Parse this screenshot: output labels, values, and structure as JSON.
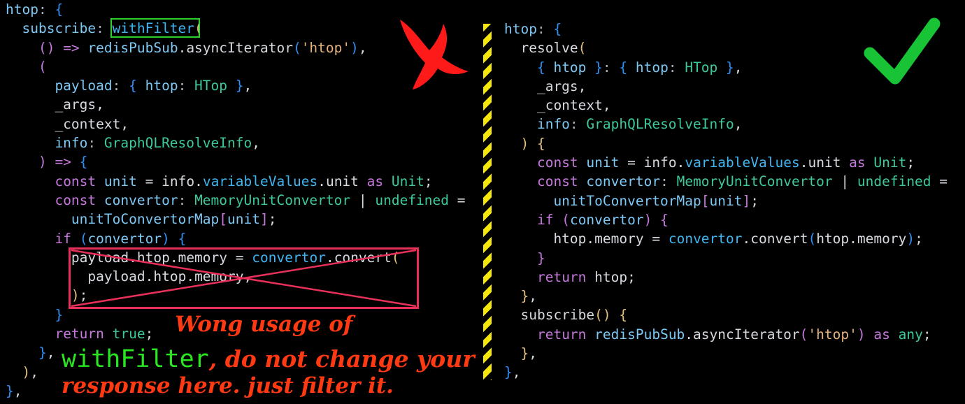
{
  "colors": {
    "background": "#000000",
    "divider_stripe": "#f5e60b",
    "highlight_box": "#2ed12e",
    "strike_box": "#e8305a",
    "annotation_red": "#ff3a12",
    "annotation_green": "#29e621",
    "check_green": "#18c436",
    "cross_red": "#ff1a1a"
  },
  "icons": {
    "wrong": "red-x-mark-icon",
    "right": "green-checkmark-icon"
  },
  "left_code": {
    "lines": [
      [
        [
          "htop",
          "c-prop"
        ],
        [
          ": ",
          "c-key"
        ],
        [
          "{",
          "c-brace"
        ]
      ],
      [
        [
          "  subscribe",
          "c-prop"
        ],
        [
          ": ",
          "c-key"
        ],
        [
          "withFilter",
          "c-func"
        ],
        [
          "(",
          "c-brace3"
        ]
      ],
      [
        [
          "    ",
          "c-plain"
        ],
        [
          "() => ",
          "c-kw"
        ],
        [
          "redisPubSub",
          "c-prop"
        ],
        [
          ".",
          "c-plain"
        ],
        [
          "asyncIterator",
          "c-plain"
        ],
        [
          "(",
          "c-brace"
        ],
        [
          "'htop'",
          "c-str"
        ],
        [
          ")",
          "c-brace"
        ],
        [
          ",",
          "c-plain"
        ]
      ],
      [
        [
          "    ",
          "c-plain"
        ],
        [
          "(",
          "c-brace2"
        ]
      ],
      [
        [
          "      payload",
          "c-prop"
        ],
        [
          ": ",
          "c-key"
        ],
        [
          "{ ",
          "c-brace"
        ],
        [
          "htop",
          "c-prop"
        ],
        [
          ": ",
          "c-key"
        ],
        [
          "HTop ",
          "c-type"
        ],
        [
          "}",
          "c-brace"
        ],
        [
          ",",
          "c-plain"
        ]
      ],
      [
        [
          "      _args,",
          "c-plain"
        ]
      ],
      [
        [
          "      _context,",
          "c-plain"
        ]
      ],
      [
        [
          "      info",
          "c-prop"
        ],
        [
          ": ",
          "c-key"
        ],
        [
          "GraphQLResolveInfo",
          "c-type"
        ],
        [
          ",",
          "c-plain"
        ]
      ],
      [
        [
          "    ",
          "c-plain"
        ],
        [
          ") => ",
          "c-brace2"
        ],
        [
          "{",
          "c-brace"
        ]
      ],
      [
        [
          "      ",
          "c-plain"
        ],
        [
          "const ",
          "c-kw"
        ],
        [
          "unit",
          "c-prop"
        ],
        [
          " = ",
          "c-plain"
        ],
        [
          "info",
          "c-plain"
        ],
        [
          ".",
          "c-plain"
        ],
        [
          "variableValues",
          "c-func"
        ],
        [
          ".",
          "c-plain"
        ],
        [
          "unit ",
          "c-plain"
        ],
        [
          "as ",
          "c-kw"
        ],
        [
          "Unit",
          "c-type"
        ],
        [
          ";",
          "c-plain"
        ]
      ],
      [
        [
          "      ",
          "c-plain"
        ],
        [
          "const ",
          "c-kw"
        ],
        [
          "convertor",
          "c-prop"
        ],
        [
          ": ",
          "c-key"
        ],
        [
          "MemoryUnitConvertor ",
          "c-type"
        ],
        [
          "| ",
          "c-plain"
        ],
        [
          "undefined ",
          "c-type"
        ],
        [
          "=",
          "c-plain"
        ]
      ],
      [
        [
          "        unitToConvertorMap",
          "c-prop"
        ],
        [
          "[",
          "c-brace2"
        ],
        [
          "unit",
          "c-prop"
        ],
        [
          "]",
          "c-brace2"
        ],
        [
          ";",
          "c-plain"
        ]
      ],
      [
        [
          "      ",
          "c-plain"
        ],
        [
          "if ",
          "c-kw"
        ],
        [
          "(",
          "c-brace"
        ],
        [
          "convertor",
          "c-prop"
        ],
        [
          ") ",
          "c-brace"
        ],
        [
          "{",
          "c-brace"
        ]
      ],
      [
        [
          "        payload",
          "c-plain"
        ],
        [
          ".",
          "c-plain"
        ],
        [
          "htop",
          "c-plain"
        ],
        [
          ".",
          "c-plain"
        ],
        [
          "memory",
          "c-plain"
        ],
        [
          " = ",
          "c-plain"
        ],
        [
          "convertor",
          "c-func"
        ],
        [
          ".",
          "c-plain"
        ],
        [
          "convert",
          "c-plain"
        ],
        [
          "(",
          "c-brace3"
        ]
      ],
      [
        [
          "          payload",
          "c-plain"
        ],
        [
          ".",
          "c-plain"
        ],
        [
          "htop",
          "c-plain"
        ],
        [
          ".",
          "c-plain"
        ],
        [
          "memory",
          "c-plain"
        ],
        [
          ",",
          "c-plain"
        ]
      ],
      [
        [
          "        ",
          "c-plain"
        ],
        [
          ")",
          "c-brace3"
        ],
        [
          ";",
          "c-plain"
        ]
      ],
      [
        [
          "      ",
          "c-plain"
        ],
        [
          "}",
          "c-brace"
        ]
      ],
      [
        [
          "      ",
          "c-plain"
        ],
        [
          "return ",
          "c-kw"
        ],
        [
          "true",
          "c-type"
        ],
        [
          ";",
          "c-plain"
        ]
      ],
      [
        [
          "    ",
          "c-plain"
        ],
        [
          "}",
          "c-brace"
        ],
        [
          ",",
          "c-plain"
        ]
      ],
      [
        [
          "  ",
          "c-plain"
        ],
        [
          ")",
          "c-brace3"
        ],
        [
          ",",
          "c-plain"
        ]
      ],
      [
        [
          "}",
          "c-brace"
        ],
        [
          ",",
          "c-plain"
        ]
      ]
    ]
  },
  "right_code": {
    "lines": [
      [
        [
          "htop",
          "c-prop"
        ],
        [
          ": ",
          "c-key"
        ],
        [
          "{",
          "c-brace"
        ]
      ],
      [
        [
          "  resolve",
          "c-plain"
        ],
        [
          "(",
          "c-brace3"
        ]
      ],
      [
        [
          "    ",
          "c-plain"
        ],
        [
          "{ ",
          "c-brace"
        ],
        [
          "htop ",
          "c-prop"
        ],
        [
          "}",
          "c-brace"
        ],
        [
          ": ",
          "c-key"
        ],
        [
          "{ ",
          "c-brace"
        ],
        [
          "htop",
          "c-prop"
        ],
        [
          ": ",
          "c-key"
        ],
        [
          "HTop ",
          "c-type"
        ],
        [
          "}",
          "c-brace"
        ],
        [
          ",",
          "c-plain"
        ]
      ],
      [
        [
          "    _args,",
          "c-plain"
        ]
      ],
      [
        [
          "    _context,",
          "c-plain"
        ]
      ],
      [
        [
          "    info",
          "c-prop"
        ],
        [
          ": ",
          "c-key"
        ],
        [
          "GraphQLResolveInfo",
          "c-type"
        ],
        [
          ",",
          "c-plain"
        ]
      ],
      [
        [
          "  ",
          "c-plain"
        ],
        [
          ") ",
          "c-brace3"
        ],
        [
          "{",
          "c-brace3"
        ]
      ],
      [
        [
          "    ",
          "c-plain"
        ],
        [
          "const ",
          "c-kw"
        ],
        [
          "unit",
          "c-prop"
        ],
        [
          " = ",
          "c-plain"
        ],
        [
          "info",
          "c-plain"
        ],
        [
          ".",
          "c-plain"
        ],
        [
          "variableValues",
          "c-func"
        ],
        [
          ".",
          "c-plain"
        ],
        [
          "unit ",
          "c-plain"
        ],
        [
          "as ",
          "c-kw"
        ],
        [
          "Unit",
          "c-type"
        ],
        [
          ";",
          "c-plain"
        ]
      ],
      [
        [
          "    ",
          "c-plain"
        ],
        [
          "const ",
          "c-kw"
        ],
        [
          "convertor",
          "c-prop"
        ],
        [
          ": ",
          "c-key"
        ],
        [
          "MemoryUnitConvertor ",
          "c-type"
        ],
        [
          "| ",
          "c-plain"
        ],
        [
          "undefined ",
          "c-type"
        ],
        [
          "=",
          "c-plain"
        ]
      ],
      [
        [
          "      unitToConvertorMap",
          "c-prop"
        ],
        [
          "[",
          "c-brace2"
        ],
        [
          "unit",
          "c-prop"
        ],
        [
          "]",
          "c-brace2"
        ],
        [
          ";",
          "c-plain"
        ]
      ],
      [
        [
          "    ",
          "c-plain"
        ],
        [
          "if ",
          "c-kw"
        ],
        [
          "(",
          "c-brace2"
        ],
        [
          "convertor",
          "c-prop"
        ],
        [
          ") ",
          "c-brace2"
        ],
        [
          "{",
          "c-brace2"
        ]
      ],
      [
        [
          "      htop",
          "c-plain"
        ],
        [
          ".",
          "c-plain"
        ],
        [
          "memory",
          "c-plain"
        ],
        [
          " = ",
          "c-plain"
        ],
        [
          "convertor",
          "c-func"
        ],
        [
          ".",
          "c-plain"
        ],
        [
          "convert",
          "c-plain"
        ],
        [
          "(",
          "c-brace"
        ],
        [
          "htop",
          "c-plain"
        ],
        [
          ".",
          "c-plain"
        ],
        [
          "memory",
          "c-plain"
        ],
        [
          ")",
          "c-brace"
        ],
        [
          ";",
          "c-plain"
        ]
      ],
      [
        [
          "    ",
          "c-plain"
        ],
        [
          "}",
          "c-brace2"
        ]
      ],
      [
        [
          "    ",
          "c-plain"
        ],
        [
          "return ",
          "c-kw"
        ],
        [
          "htop",
          "c-plain"
        ],
        [
          ";",
          "c-plain"
        ]
      ],
      [
        [
          "  ",
          "c-plain"
        ],
        [
          "}",
          "c-brace3"
        ],
        [
          ",",
          "c-plain"
        ]
      ],
      [
        [
          "  subscribe",
          "c-plain"
        ],
        [
          "() ",
          "c-brace3"
        ],
        [
          "{",
          "c-brace3"
        ]
      ],
      [
        [
          "    ",
          "c-plain"
        ],
        [
          "return ",
          "c-kw"
        ],
        [
          "redisPubSub",
          "c-prop"
        ],
        [
          ".",
          "c-plain"
        ],
        [
          "asyncIterator",
          "c-plain"
        ],
        [
          "(",
          "c-brace2"
        ],
        [
          "'htop'",
          "c-str"
        ],
        [
          ") ",
          "c-brace2"
        ],
        [
          "as ",
          "c-kw"
        ],
        [
          "any",
          "c-type"
        ],
        [
          ";",
          "c-plain"
        ]
      ],
      [
        [
          "  ",
          "c-plain"
        ],
        [
          "}",
          "c-brace3"
        ],
        [
          ",",
          "c-plain"
        ]
      ],
      [
        [
          "}",
          "c-brace"
        ],
        [
          ",",
          "c-plain"
        ]
      ]
    ]
  },
  "annotation": {
    "line1": "Wong usage of",
    "line2_code": "withFilter",
    "line2_text": ", do not change your",
    "line3": "response here. just filter it."
  }
}
